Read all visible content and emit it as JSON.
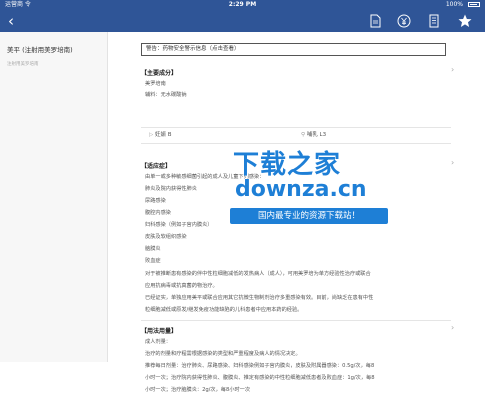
{
  "status": {
    "carrier": "运营商 令",
    "time": "2:29 PM",
    "battery": "100%"
  },
  "nav": {
    "back": "‹",
    "icons": [
      "document-icon",
      "yuan-icon",
      "list-icon",
      "star-icon"
    ]
  },
  "sidebar": {
    "title": "美平 (注射用美罗培南)",
    "subtitle": "注射用美罗培南"
  },
  "warning": {
    "label": "警告：药物安全警示信息（点击查看）"
  },
  "composition": {
    "heading": "【主要成分】",
    "lines": [
      "美罗培南",
      "辅料：无水碳酸钠"
    ],
    "levels": [
      "妊娠 B",
      "哺乳 L3"
    ]
  },
  "indications": {
    "heading": "【适应症】",
    "lines": [
      "由单一或多种敏感细菌引起的成人及儿童下列感染：",
      "肺炎及院内获得性肺炎",
      "尿路感染",
      "腹腔内感染",
      "妇科感染（例如子宫内膜炎）",
      "皮肤及软组织感染",
      "脑膜炎",
      "败血症",
      "对于被推断患有感染的伴中性粒细胞减低的发热病人（成人），可用美罗培为单方经验性治疗或联合",
      "应用抗病毒或抗真菌药物治疗。",
      "已经证实，单独应用美平或联合应用其它抗微生物制剂治疗多重感染有效。目前，尚缺乏在患有中性",
      "粒细胞减低或原发/继发免疫功能缺陷的儿科患者中应用本药的经验。"
    ]
  },
  "dosage": {
    "heading": "【用法用量】",
    "lines": [
      "成人剂量：",
      "治疗的剂量和疗程需根据感染的类型和严重程度及病人的情况决定。",
      "推荐每日剂量：治疗肺炎、尿路感染、妇科感染例如子宫内膜炎，皮肤及附属器感染：0.5g/次，每8",
      "小时一次；治疗院内获得性肺炎、腹膜炎、推定有感染的中性粒细胞减低患者及败血症：1g/次，每8",
      "小时一次；治疗脑膜炎：2g/次，每8小时一次"
    ]
  },
  "watermark": {
    "line1": "下载之家",
    "line2": "downza.cn",
    "line3": "国内最专业的资源下载站！"
  },
  "colors": {
    "navbar": "#2f5597",
    "watermark": "#1e7fd6"
  }
}
